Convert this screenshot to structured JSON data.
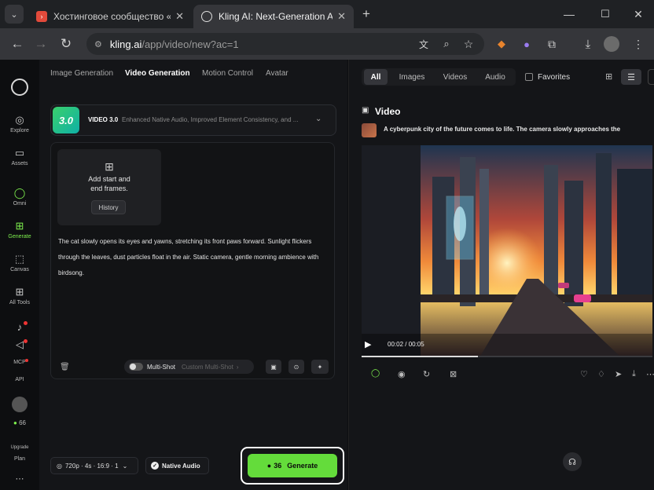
{
  "browser": {
    "tabs": [
      {
        "title": "Хостинговое сообщество «Tim"
      },
      {
        "title": "Kling AI: Next-Generation AI Cr"
      }
    ],
    "url_domain": "kling.ai",
    "url_path": "/app/video/new?ac=1"
  },
  "sidebar": {
    "items": [
      {
        "label": "Explore"
      },
      {
        "label": "Assets"
      },
      {
        "label": "Omni"
      },
      {
        "label": "Generate"
      },
      {
        "label": "Canvas"
      },
      {
        "label": "All Tools"
      },
      {
        "label": "MCP"
      },
      {
        "label": "API"
      },
      {
        "label": "66"
      },
      {
        "label": "Upgrade"
      },
      {
        "label": "Plan"
      }
    ]
  },
  "main": {
    "tabs": [
      {
        "label": "Image Generation"
      },
      {
        "label": "Video Generation"
      },
      {
        "label": "Motion Control"
      },
      {
        "label": "Avatar"
      }
    ],
    "model": {
      "badge": "3.0",
      "name": "VIDEO 3.0",
      "desc": "Enhanced Native Audio, Improved Element Consistency, and ..."
    },
    "frames": {
      "line1": "Add start and",
      "line2": "end frames.",
      "history": "History"
    },
    "prompt": "The cat slowly opens its eyes and yawns, stretching its front paws forward. Sunlight flickers through the leaves, dust particles float in the air. Static camera, gentle morning ambience with birdsong.",
    "multishot": "Multi-Shot",
    "custom_multishot": "Custom Multi-Shot",
    "settings": "720p · 4s · 16:9 · 1",
    "native_audio": "Native Audio",
    "generate_cost": "36",
    "generate_label": "Generate"
  },
  "gallery": {
    "filters": [
      {
        "label": "All"
      },
      {
        "label": "Images"
      },
      {
        "label": "Videos"
      },
      {
        "label": "Audio"
      }
    ],
    "favorites": "Favorites",
    "section_title": "Video",
    "item_prompt": "A cyberpunk city of the future comes to life. The camera slowly approaches the",
    "time": "00:02 / 00:05",
    "progress": 0.4
  },
  "colors": {
    "accent": "#7ef04e",
    "generate_bg": "#64dc3b"
  }
}
